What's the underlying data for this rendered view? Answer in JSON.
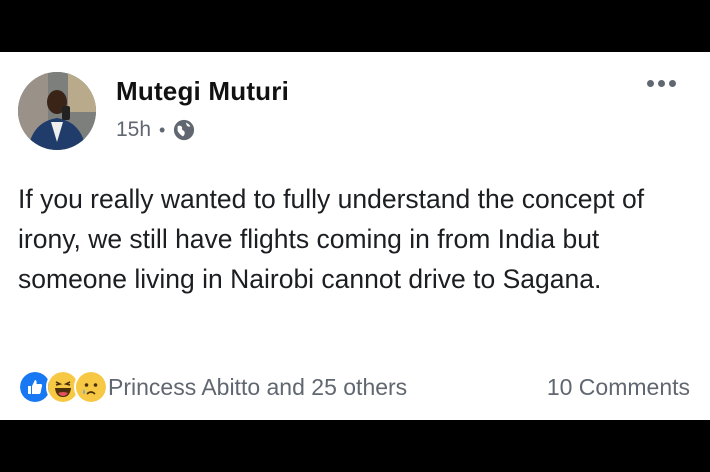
{
  "post": {
    "author": "Mutegi Muturi",
    "timestamp": "15h",
    "separator": "•",
    "privacy_icon": "globe-icon",
    "more_icon": "more-options-icon",
    "text": "If you really wanted to fully understand the concept of irony, we still have flights coming in from India but someone living in Nairobi cannot drive to Sagana."
  },
  "footer": {
    "reaction_icons": [
      "like-icon",
      "haha-icon",
      "sad-icon"
    ],
    "reactions_text": "Princess Abitto and 25 others",
    "comments_text": "10 Comments"
  },
  "colors": {
    "like": "#1877f2",
    "emoji_yellow": "#f7c844",
    "meta_gray": "#606770"
  }
}
